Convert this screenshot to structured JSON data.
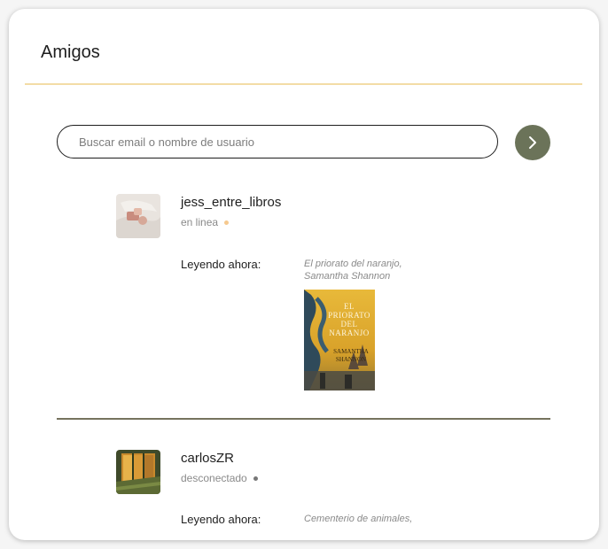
{
  "page": {
    "title": "Amigos"
  },
  "search": {
    "placeholder": "Buscar email o nombre de usuario"
  },
  "colors": {
    "accent": "#6b7359",
    "title_rule": "#f3dca6",
    "divider": "#76735e",
    "online_dot": "#f6c98f",
    "offline_dot": "#777777"
  },
  "friends": [
    {
      "username": "jess_entre_libros",
      "status": "en linea",
      "reading_label": "Leyendo ahora:",
      "book_title": "El priorato del naranjo,",
      "book_author": "Samantha Shannon",
      "cover_title_lines": [
        "EL",
        "PRIORATO",
        "DEL",
        "NARANJO"
      ],
      "cover_author_lines": [
        "SAMANTHA",
        "SHANNON"
      ]
    },
    {
      "username": "carlosZR",
      "status": "desconectado",
      "reading_label": "Leyendo ahora:",
      "book_title": "Cementerio de animales,"
    }
  ]
}
